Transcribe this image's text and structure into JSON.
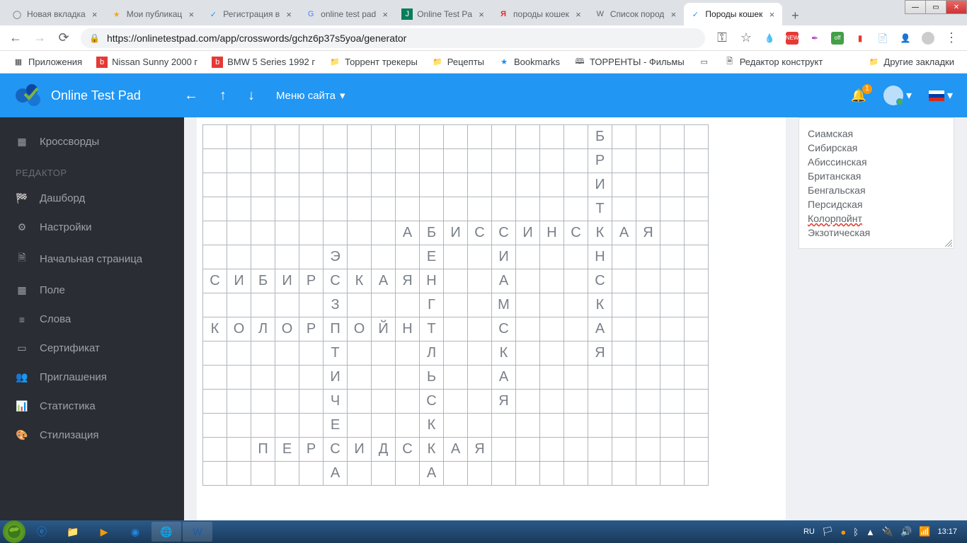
{
  "browser": {
    "tabs": [
      {
        "title": "Новая вкладка"
      },
      {
        "title": "Мои публикац"
      },
      {
        "title": "Регистрация в"
      },
      {
        "title": "online test pad"
      },
      {
        "title": "Online Test Pa"
      },
      {
        "title": "породы кошек"
      },
      {
        "title": "Список пород"
      },
      {
        "title": "Породы кошек"
      }
    ],
    "url": "https://onlinetestpad.com/app/crosswords/gchz6p37s5yoa/generator"
  },
  "bookmarks": {
    "apps": "Приложения",
    "items": [
      "Nissan Sunny 2000 г",
      "BMW 5 Series 1992 г",
      "Торрент трекеры",
      "Рецепты",
      "Bookmarks",
      "ТОРРЕНТЫ - Фильмы",
      "Редактор конструкт"
    ],
    "other": "Другие закладки"
  },
  "app": {
    "brand": "Online Test Pad",
    "menu": "Меню сайта",
    "notif_count": "1"
  },
  "sidebar": {
    "top": {
      "label": "Кроссворды"
    },
    "heading": "РЕДАКТОР",
    "items": [
      {
        "label": "Дашборд"
      },
      {
        "label": "Настройки"
      },
      {
        "label": "Начальная страница"
      },
      {
        "label": "Поле"
      },
      {
        "label": "Слова"
      },
      {
        "label": "Сертификат"
      },
      {
        "label": "Приглашения"
      },
      {
        "label": "Статистика"
      },
      {
        "label": "Стилизация"
      }
    ]
  },
  "words": [
    "Сиамская",
    "Сибирская",
    "Абиссинская",
    "Британская",
    "Бенгальская",
    "Персидская",
    "Колорпойнт",
    "Экзотическая"
  ],
  "crossword": {
    "cols": 21,
    "rows": 15,
    "cells": [
      {
        "r": 0,
        "c": 16,
        "t": "Б"
      },
      {
        "r": 1,
        "c": 16,
        "t": "Р"
      },
      {
        "r": 2,
        "c": 16,
        "t": "И"
      },
      {
        "r": 3,
        "c": 16,
        "t": "Т"
      },
      {
        "r": 4,
        "c": 8,
        "t": "А"
      },
      {
        "r": 4,
        "c": 9,
        "t": "Б"
      },
      {
        "r": 4,
        "c": 10,
        "t": "И"
      },
      {
        "r": 4,
        "c": 11,
        "t": "С"
      },
      {
        "r": 4,
        "c": 12,
        "t": "С"
      },
      {
        "r": 4,
        "c": 13,
        "t": "И"
      },
      {
        "r": 4,
        "c": 14,
        "t": "Н"
      },
      {
        "r": 4,
        "c": 15,
        "t": "С"
      },
      {
        "r": 4,
        "c": 16,
        "t": "К"
      },
      {
        "r": 4,
        "c": 17,
        "t": "А"
      },
      {
        "r": 4,
        "c": 18,
        "t": "Я"
      },
      {
        "r": 5,
        "c": 5,
        "t": "Э"
      },
      {
        "r": 5,
        "c": 9,
        "t": "Е"
      },
      {
        "r": 5,
        "c": 12,
        "t": "И"
      },
      {
        "r": 5,
        "c": 16,
        "t": "Н"
      },
      {
        "r": 6,
        "c": 0,
        "t": "С"
      },
      {
        "r": 6,
        "c": 1,
        "t": "И"
      },
      {
        "r": 6,
        "c": 2,
        "t": "Б"
      },
      {
        "r": 6,
        "c": 3,
        "t": "И"
      },
      {
        "r": 6,
        "c": 4,
        "t": "Р"
      },
      {
        "r": 6,
        "c": 5,
        "t": "С"
      },
      {
        "r": 6,
        "c": 6,
        "t": "К"
      },
      {
        "r": 6,
        "c": 7,
        "t": "А"
      },
      {
        "r": 6,
        "c": 8,
        "t": "Я"
      },
      {
        "r": 6,
        "c": 9,
        "t": "Н"
      },
      {
        "r": 6,
        "c": 12,
        "t": "А"
      },
      {
        "r": 6,
        "c": 16,
        "t": "С"
      },
      {
        "r": 7,
        "c": 5,
        "t": "З"
      },
      {
        "r": 7,
        "c": 9,
        "t": "Г"
      },
      {
        "r": 7,
        "c": 12,
        "t": "М"
      },
      {
        "r": 7,
        "c": 16,
        "t": "К"
      },
      {
        "r": 8,
        "c": 0,
        "t": "К"
      },
      {
        "r": 8,
        "c": 1,
        "t": "О"
      },
      {
        "r": 8,
        "c": 2,
        "t": "Л"
      },
      {
        "r": 8,
        "c": 3,
        "t": "О"
      },
      {
        "r": 8,
        "c": 4,
        "t": "Р"
      },
      {
        "r": 8,
        "c": 5,
        "t": "П"
      },
      {
        "r": 8,
        "c": 6,
        "t": "О"
      },
      {
        "r": 8,
        "c": 7,
        "t": "Й"
      },
      {
        "r": 8,
        "c": 8,
        "t": "Н"
      },
      {
        "r": 8,
        "c": 9,
        "t": "Т"
      },
      {
        "r": 8,
        "c": 12,
        "t": "С"
      },
      {
        "r": 8,
        "c": 16,
        "t": "А"
      },
      {
        "r": 9,
        "c": 5,
        "t": "Т"
      },
      {
        "r": 9,
        "c": 9,
        "t": "Л"
      },
      {
        "r": 9,
        "c": 12,
        "t": "К"
      },
      {
        "r": 9,
        "c": 16,
        "t": "Я"
      },
      {
        "r": 10,
        "c": 5,
        "t": "И"
      },
      {
        "r": 10,
        "c": 9,
        "t": "Ь"
      },
      {
        "r": 10,
        "c": 12,
        "t": "А"
      },
      {
        "r": 11,
        "c": 5,
        "t": "Ч"
      },
      {
        "r": 11,
        "c": 9,
        "t": "С"
      },
      {
        "r": 11,
        "c": 12,
        "t": "Я"
      },
      {
        "r": 12,
        "c": 5,
        "t": "Е"
      },
      {
        "r": 12,
        "c": 9,
        "t": "К"
      },
      {
        "r": 13,
        "c": 2,
        "t": "П"
      },
      {
        "r": 13,
        "c": 3,
        "t": "Е"
      },
      {
        "r": 13,
        "c": 4,
        "t": "Р"
      },
      {
        "r": 13,
        "c": 5,
        "t": "С"
      },
      {
        "r": 13,
        "c": 6,
        "t": "И"
      },
      {
        "r": 13,
        "c": 7,
        "t": "Д"
      },
      {
        "r": 13,
        "c": 8,
        "t": "С"
      },
      {
        "r": 13,
        "c": 9,
        "t": "К"
      },
      {
        "r": 13,
        "c": 10,
        "t": "А"
      },
      {
        "r": 13,
        "c": 11,
        "t": "Я"
      },
      {
        "r": 14,
        "c": 5,
        "t": "А"
      },
      {
        "r": 14,
        "c": 9,
        "t": "А"
      }
    ]
  },
  "taskbar": {
    "lang": "RU",
    "time": "13:17"
  }
}
